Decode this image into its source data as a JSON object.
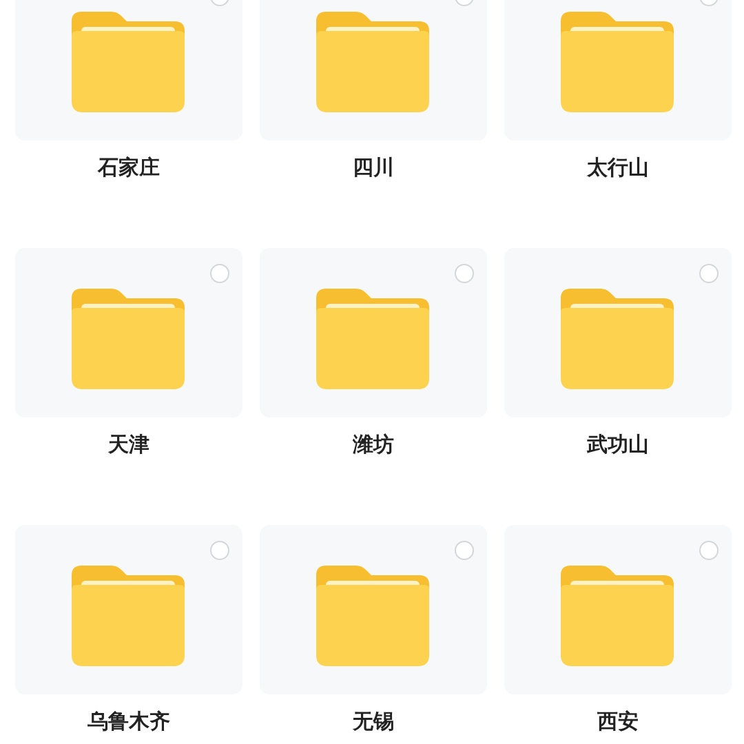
{
  "folders": [
    {
      "name": "石家庄",
      "selected": false
    },
    {
      "name": "四川",
      "selected": false
    },
    {
      "name": "太行山",
      "selected": false
    },
    {
      "name": "天津",
      "selected": false
    },
    {
      "name": "潍坊",
      "selected": false
    },
    {
      "name": "武功山",
      "selected": false
    },
    {
      "name": "乌鲁木齐",
      "selected": false
    },
    {
      "name": "无锡",
      "selected": false
    },
    {
      "name": "西安",
      "selected": false
    }
  ]
}
